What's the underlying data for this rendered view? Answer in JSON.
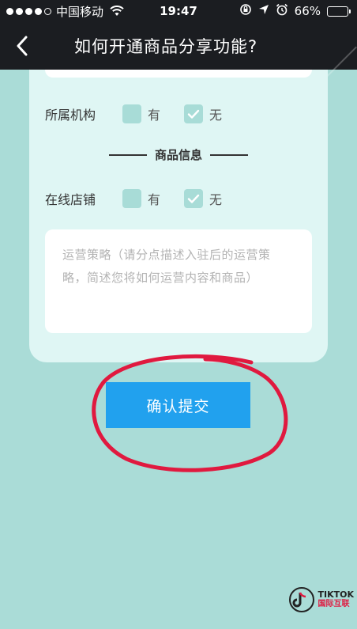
{
  "status_bar": {
    "carrier": "中国移动",
    "time": "19:47",
    "battery_percent": "66%",
    "battery_level": 0.66,
    "signal_strength": 4,
    "signal_max": 5
  },
  "nav": {
    "title": "如何开通商品分享功能?",
    "back_icon": "chevron-left-icon"
  },
  "form": {
    "org_row": {
      "label": "所属机构",
      "options": [
        {
          "label": "有",
          "checked": false
        },
        {
          "label": "无",
          "checked": true
        }
      ]
    },
    "section_title": "商品信息",
    "shop_row": {
      "label": "在线店铺",
      "options": [
        {
          "label": "有",
          "checked": false
        },
        {
          "label": "无",
          "checked": true
        }
      ]
    },
    "strategy": {
      "value": "",
      "placeholder": "运营策略（请分点描述入驻后的运营策略，简述您将如何运营内容和商品）"
    }
  },
  "submit_label": "确认提交",
  "watermark": {
    "line1": "TIKTOK",
    "line2": "国际互联"
  },
  "colors": {
    "background": "#aadcd7",
    "card": "#dff6f4",
    "button": "#21a1ee",
    "nav": "#1b1d21",
    "annotation": "#e0193f"
  }
}
